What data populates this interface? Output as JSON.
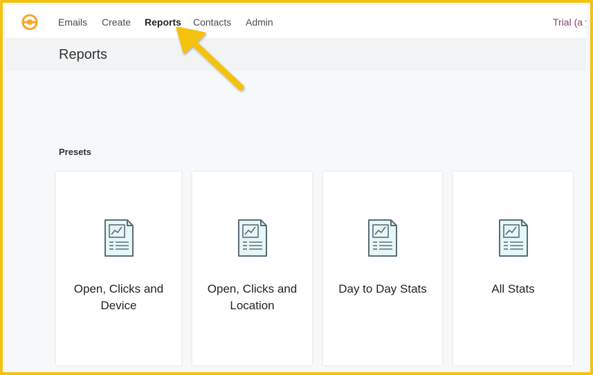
{
  "nav": {
    "items": [
      {
        "label": "Emails"
      },
      {
        "label": "Create"
      },
      {
        "label": "Reports",
        "active": true
      },
      {
        "label": "Contacts"
      },
      {
        "label": "Admin"
      }
    ],
    "account": "Trial (a y"
  },
  "page": {
    "title": "Reports",
    "presets_label": "Presets"
  },
  "presets": [
    {
      "line1": "Open, Clicks and",
      "line2": "Device",
      "icon": "report-document-icon"
    },
    {
      "line1": "Open, Clicks and",
      "line2": "Location",
      "icon": "report-document-icon"
    },
    {
      "line1": "Day to Day Stats",
      "line2": "",
      "icon": "report-document-icon"
    },
    {
      "line1": "All Stats",
      "line2": "",
      "icon": "report-document-icon"
    }
  ],
  "colors": {
    "highlight": "#f4c20d",
    "logo": "#f5a623",
    "account_text": "#8e3b78",
    "icon_fill": "#e6f7f7",
    "icon_stroke": "#5a6b75"
  }
}
